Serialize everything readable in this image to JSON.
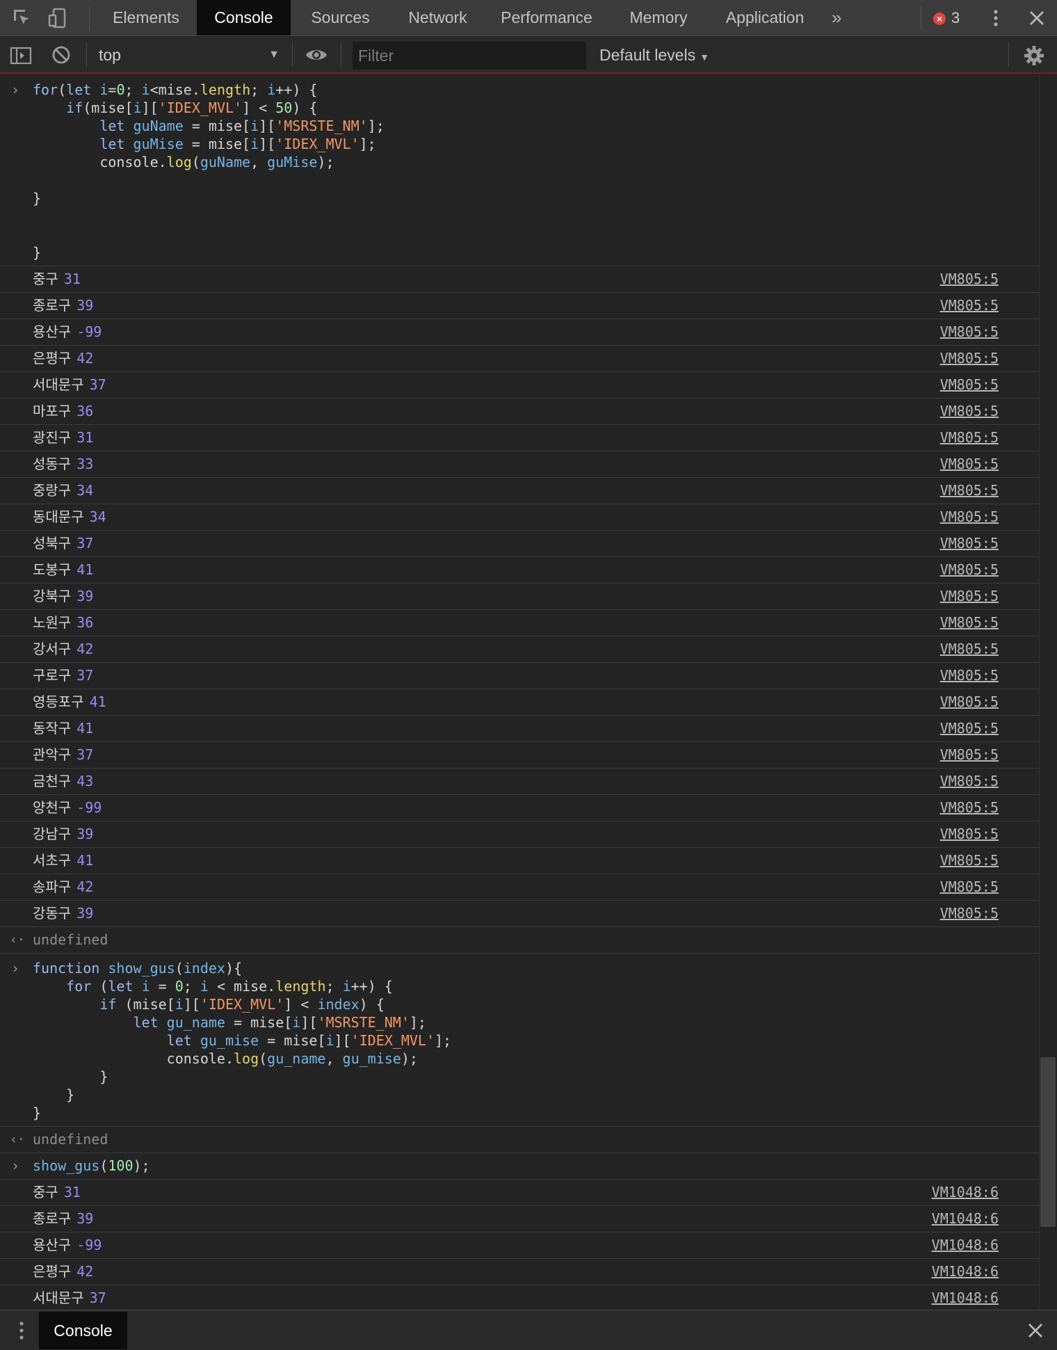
{
  "tabs": [
    {
      "label": "Elements",
      "active": false
    },
    {
      "label": "Console",
      "active": true
    },
    {
      "label": "Sources",
      "active": false
    },
    {
      "label": "Network",
      "active": false
    },
    {
      "label": "Performance",
      "active": false
    },
    {
      "label": "Memory",
      "active": false
    },
    {
      "label": "Application",
      "active": false
    }
  ],
  "tabbar": {
    "overflow_icon": "double-chevron-right-icon",
    "error_count": "3",
    "error_icon": "error-x-icon",
    "menu_icon": "vertical-dots-icon",
    "close_icon": "close-icon"
  },
  "toolbar": {
    "context": "top",
    "filter_placeholder": "Filter",
    "levels": "Default levels"
  },
  "colors": {
    "background": "#242424",
    "tabbar": "#3c3c3c",
    "active_tab": "#0d0d0d",
    "number": "#9a8cf3",
    "string": "#f29766",
    "keyword": "#9ab8f2",
    "error": "#e34444"
  },
  "block1": {
    "lines": [
      "for(let i=0; i<mise.length; i++) {",
      "    if(mise[i]['IDEX_MVL'] < 50) {",
      "        let guName = mise[i]['MSRSTE_NM'];",
      "        let guMise = mise[i]['IDEX_MVL'];",
      "        console.log(guName, guMise);",
      "",
      "}",
      "",
      "",
      "}"
    ],
    "source": "VM805:5",
    "logs": [
      {
        "name": "중구",
        "value": "31"
      },
      {
        "name": "종로구",
        "value": "39"
      },
      {
        "name": "용산구",
        "value": "-99"
      },
      {
        "name": "은평구",
        "value": "42"
      },
      {
        "name": "서대문구",
        "value": "37"
      },
      {
        "name": "마포구",
        "value": "36"
      },
      {
        "name": "광진구",
        "value": "31"
      },
      {
        "name": "성동구",
        "value": "33"
      },
      {
        "name": "중랑구",
        "value": "34"
      },
      {
        "name": "동대문구",
        "value": "34"
      },
      {
        "name": "성북구",
        "value": "37"
      },
      {
        "name": "도봉구",
        "value": "41"
      },
      {
        "name": "강북구",
        "value": "39"
      },
      {
        "name": "노원구",
        "value": "36"
      },
      {
        "name": "강서구",
        "value": "42"
      },
      {
        "name": "구로구",
        "value": "37"
      },
      {
        "name": "영등포구",
        "value": "41"
      },
      {
        "name": "동작구",
        "value": "41"
      },
      {
        "name": "관악구",
        "value": "37"
      },
      {
        "name": "금천구",
        "value": "43"
      },
      {
        "name": "양천구",
        "value": "-99"
      },
      {
        "name": "강남구",
        "value": "39"
      },
      {
        "name": "서초구",
        "value": "41"
      },
      {
        "name": "송파구",
        "value": "42"
      },
      {
        "name": "강동구",
        "value": "39"
      }
    ]
  },
  "return1": "undefined",
  "block2": {
    "lines": [
      "function show_gus(index){",
      "    for (let i = 0; i < mise.length; i++) {",
      "        if (mise[i]['IDEX_MVL'] < index) {",
      "            let gu_name = mise[i]['MSRSTE_NM'];",
      "                let gu_mise = mise[i]['IDEX_MVL'];",
      "                console.log(gu_name, gu_mise);",
      "        }",
      "    }",
      "}"
    ]
  },
  "return2": "undefined",
  "command3": "show_gus(100);",
  "block3": {
    "source": "VM1048:6",
    "logs": [
      {
        "name": "중구",
        "value": "31"
      },
      {
        "name": "종로구",
        "value": "39"
      },
      {
        "name": "용산구",
        "value": "-99"
      },
      {
        "name": "은평구",
        "value": "42"
      },
      {
        "name": "서대문구",
        "value": "37"
      }
    ]
  },
  "drawer": {
    "tab": "Console",
    "menu_icon": "vertical-dots-icon",
    "close_icon": "close-icon"
  }
}
